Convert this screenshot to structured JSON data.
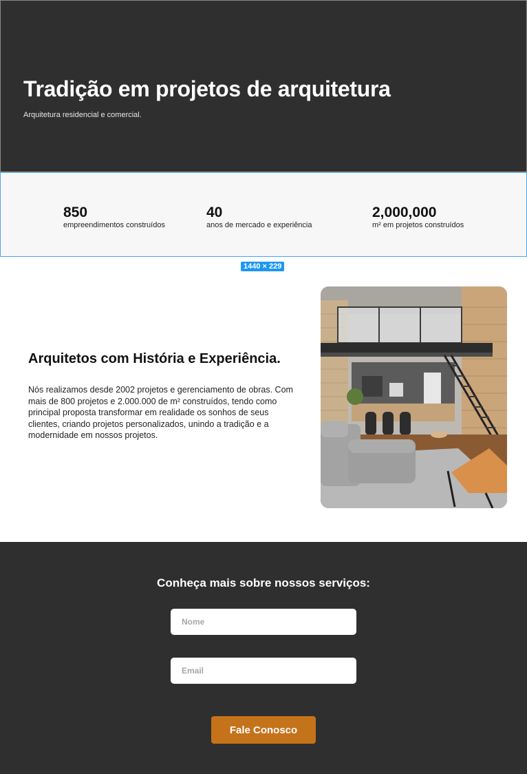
{
  "hero": {
    "title": "Tradição em projetos de arquitetura",
    "subtitle": "Arquitetura residencial e comercial."
  },
  "stats": [
    {
      "value": "850",
      "label": "empreendimentos construídos"
    },
    {
      "value": "40",
      "label": "anos de mercado e experiência"
    },
    {
      "value": "2,000,000",
      "label": "m² em projetos construídos"
    }
  ],
  "frame_badge": "1440 × 229",
  "about": {
    "title": "Arquitetos com História e Experiência.",
    "text": "Nós realizamos desde 2002 projetos e gerenciamento de obras. Com mais de 800 projetos e 2.000.000 de m² construídos, tendo como principal proposta transformar em realidade os sonhos de seus clientes, criando projetos personalizados, unindo a tradição e a modernidade em nossos projetos."
  },
  "contact": {
    "title": "Conheça mais sobre nossos serviços:",
    "name_placeholder": "Nome",
    "email_placeholder": "Email",
    "button_label": "Fale Conosco"
  },
  "colors": {
    "dark_bg": "#2f2f2f",
    "accent": "#c5731b",
    "selection_blue": "#1d97f2"
  }
}
